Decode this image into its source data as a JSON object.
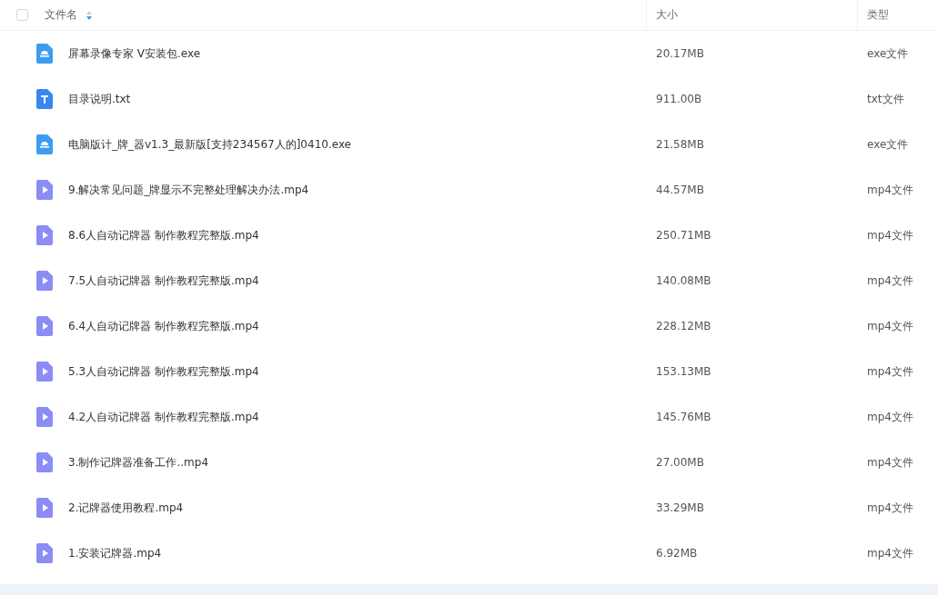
{
  "header": {
    "select_all": {
      "checked": false
    },
    "columns": [
      "文件名",
      "大小",
      "类型"
    ]
  },
  "rows": [
    {
      "kind": "app",
      "name": "屏幕录像专家 V安装包.exe",
      "size": "20.17MB",
      "type": "exe文件"
    },
    {
      "kind": "text",
      "name": "目录说明.txt",
      "size": "911.00B",
      "type": "txt文件"
    },
    {
      "kind": "app",
      "name": "电脑版计_牌_器v1.3_最新版[支持234567人的]0410.exe",
      "size": "21.58MB",
      "type": "exe文件"
    },
    {
      "kind": "video",
      "name": "9.解决常见问题_牌显示不完整处理解决办法.mp4",
      "size": "44.57MB",
      "type": "mp4文件"
    },
    {
      "kind": "video",
      "name": "8.6人自动记牌器 制作教程完整版.mp4",
      "size": "250.71MB",
      "type": "mp4文件"
    },
    {
      "kind": "video",
      "name": "7.5人自动记牌器 制作教程完整版.mp4",
      "size": "140.08MB",
      "type": "mp4文件"
    },
    {
      "kind": "video",
      "name": "6.4人自动记牌器 制作教程完整版.mp4",
      "size": "228.12MB",
      "type": "mp4文件"
    },
    {
      "kind": "video",
      "name": "5.3人自动记牌器 制作教程完整版.mp4",
      "size": "153.13MB",
      "type": "mp4文件"
    },
    {
      "kind": "video",
      "name": "4.2人自动记牌器 制作教程完整版.mp4",
      "size": "145.76MB",
      "type": "mp4文件"
    },
    {
      "kind": "video",
      "name": "3.制作记牌器准备工作..mp4",
      "size": "27.00MB",
      "type": "mp4文件"
    },
    {
      "kind": "video",
      "name": "2.记牌器使用教程.mp4",
      "size": "33.29MB",
      "type": "mp4文件"
    },
    {
      "kind": "video",
      "name": "1.安装记牌器.mp4",
      "size": "6.92MB",
      "type": "mp4文件"
    }
  ]
}
